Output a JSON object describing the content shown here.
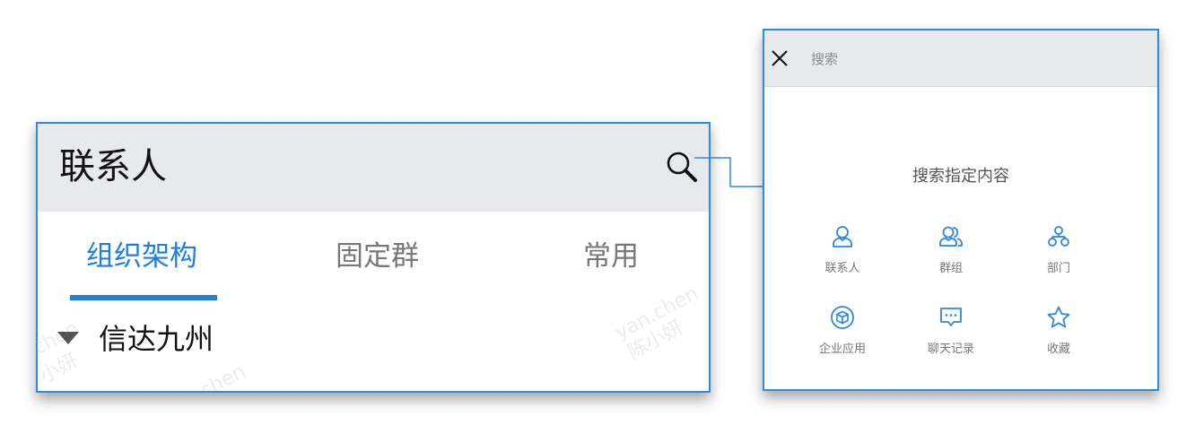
{
  "contacts_panel": {
    "title": "联系人",
    "tabs": [
      {
        "label": "组织架构",
        "active": true
      },
      {
        "label": "固定群",
        "active": false
      },
      {
        "label": "常用",
        "active": false
      }
    ],
    "tree": [
      {
        "label": "信达九州",
        "expanded": true
      }
    ],
    "watermarks": [
      "yan.chen",
      "陈小妍",
      "chen",
      "小妍",
      "chen"
    ]
  },
  "search_panel": {
    "search_placeholder": "搜索",
    "hint": "搜索指定内容",
    "categories": [
      {
        "label": "联系人",
        "icon": "person-icon"
      },
      {
        "label": "群组",
        "icon": "group-icon"
      },
      {
        "label": "部门",
        "icon": "department-icon"
      },
      {
        "label": "企业应用",
        "icon": "cube-icon"
      },
      {
        "label": "聊天记录",
        "icon": "chat-icon"
      },
      {
        "label": "收藏",
        "icon": "star-icon"
      }
    ]
  },
  "colors": {
    "accent": "#1f7fdd",
    "border": "#2f8ae6",
    "header_bg": "#e7e9ec",
    "icon_blue": "#2b86e0"
  }
}
